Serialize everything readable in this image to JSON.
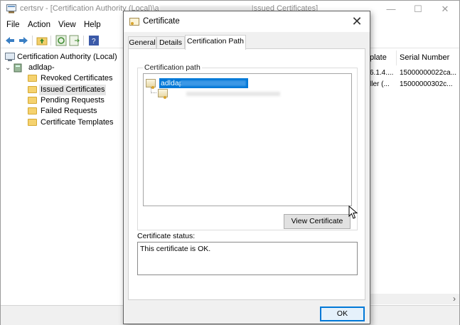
{
  "main_window": {
    "title_prefix": "certsrv - [Certification Authority (Local)\\a",
    "title_suffix": "Issued Certificates]",
    "controls": {
      "minimize": "—",
      "maximize": "☐",
      "close": "✕"
    }
  },
  "menu": [
    "File",
    "Action",
    "View",
    "Help"
  ],
  "tree": {
    "root": "Certification Authority (Local)",
    "ca_node": "adldap-",
    "items": [
      "Revoked Certificates",
      "Issued Certificates",
      "Pending Requests",
      "Failed Requests",
      "Certificate Templates"
    ],
    "selected_index": 1
  },
  "list": {
    "columns": [
      "plate",
      "Serial Number"
    ],
    "rows": [
      [
        "6.1.4....",
        "15000000022ca..."
      ],
      [
        "ller (...",
        "15000000302c..."
      ]
    ]
  },
  "dialog": {
    "title": "Certificate",
    "close": "✕",
    "tabs": [
      "General",
      "Details",
      "Certification Path"
    ],
    "active_tab": 2,
    "path_group_label": "Certification path",
    "path_nodes": [
      "adldap-"
    ],
    "view_certificate_button": "View Certificate",
    "status_label": "Certificate status:",
    "status_text": "This certificate is OK.",
    "ok_button": "OK"
  },
  "colors": {
    "selection": "#0078d7",
    "dialog_bg": "#f0f0f0",
    "folder": "#f5d26e"
  },
  "scroll_arrow": "›"
}
